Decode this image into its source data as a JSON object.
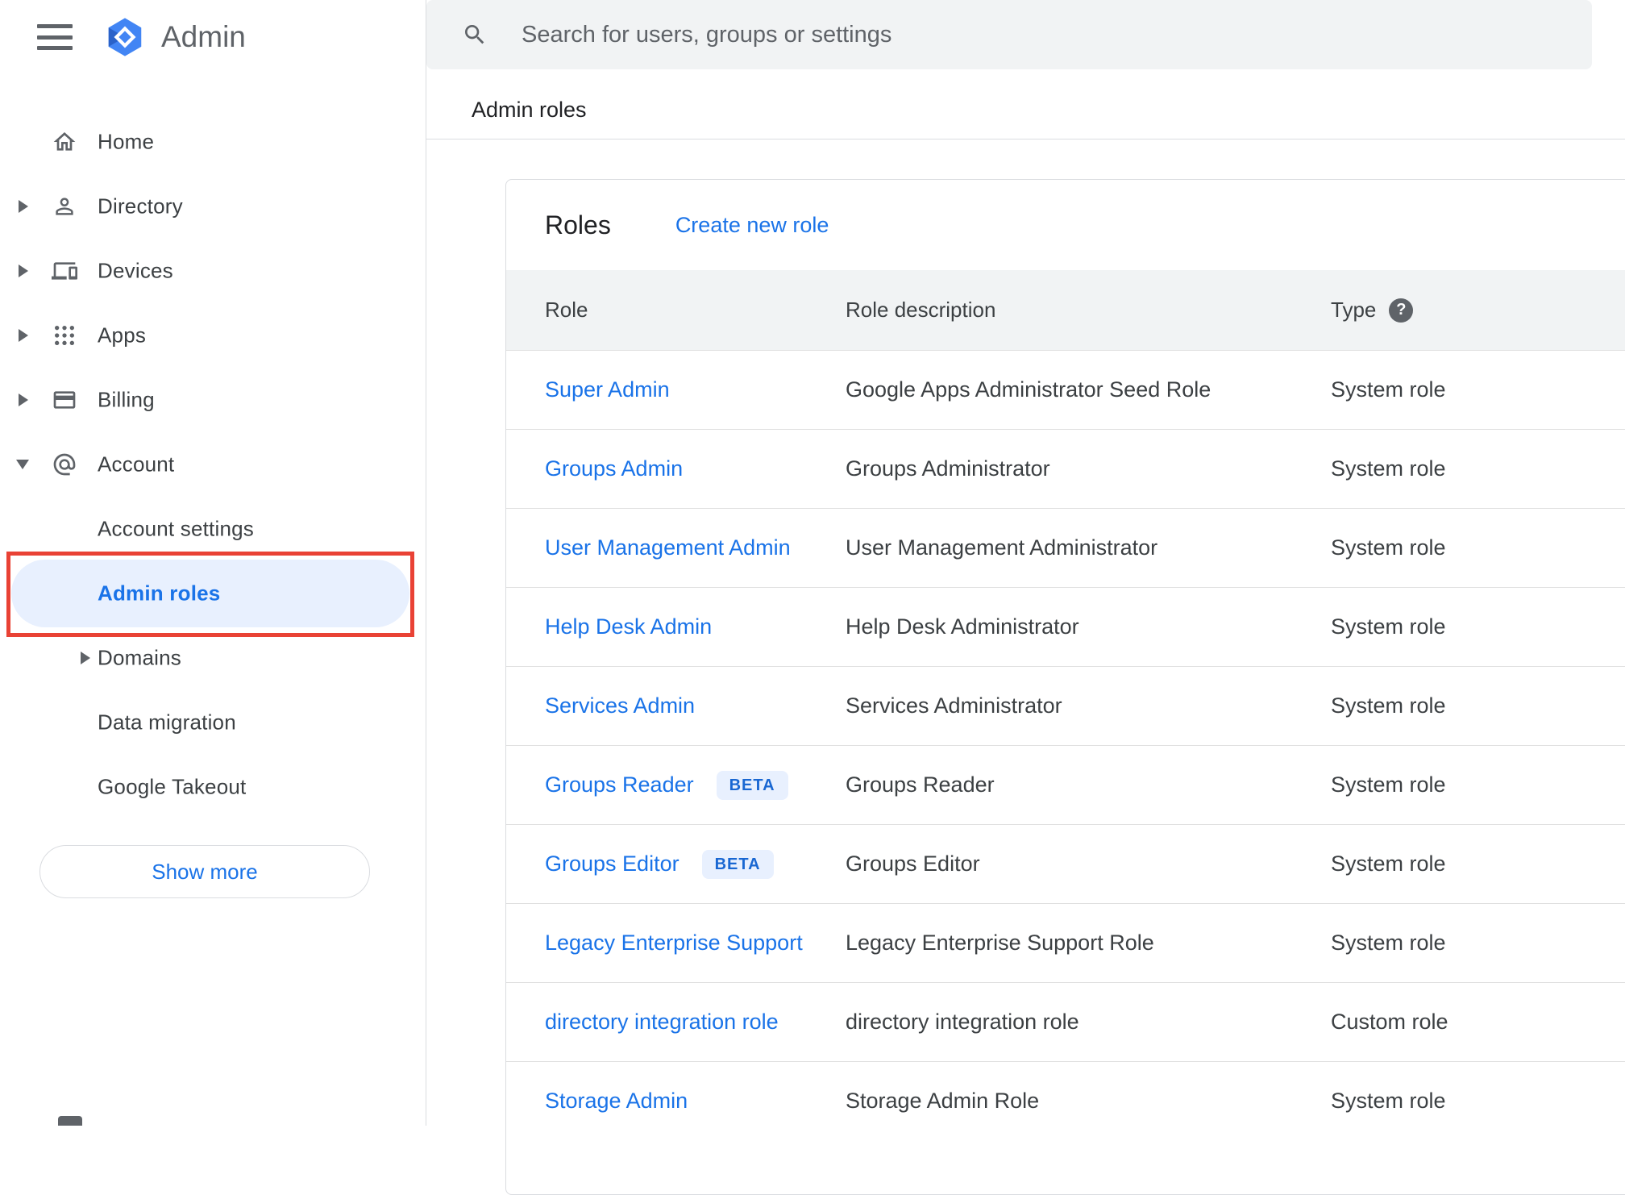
{
  "app": {
    "name": "Admin"
  },
  "search": {
    "placeholder": "Search for users, groups or settings"
  },
  "page": {
    "breadcrumb": "Admin roles"
  },
  "icons": {
    "help_glyph": "?"
  },
  "sidebar": {
    "items": [
      {
        "label": "Home",
        "icon": "home",
        "expandable": false
      },
      {
        "label": "Directory",
        "icon": "person",
        "expandable": true
      },
      {
        "label": "Devices",
        "icon": "devices",
        "expandable": true
      },
      {
        "label": "Apps",
        "icon": "apps-grid",
        "expandable": true
      },
      {
        "label": "Billing",
        "icon": "billing-card",
        "expandable": true
      },
      {
        "label": "Account",
        "icon": "at-sign",
        "expandable": true,
        "expanded": true
      }
    ],
    "account_items": [
      {
        "label": "Account settings",
        "selected": false
      },
      {
        "label": "Admin roles",
        "selected": true,
        "annotated": true
      },
      {
        "label": "Domains",
        "expandable": true,
        "selected": false
      },
      {
        "label": "Data migration",
        "selected": false
      },
      {
        "label": "Google Takeout",
        "selected": false
      }
    ],
    "show_more": "Show more"
  },
  "main": {
    "title": "Roles",
    "create_link": "Create new role",
    "table": {
      "columns": [
        "Role",
        "Role description",
        "Type"
      ],
      "rows": [
        {
          "role": "Super Admin",
          "description": "Google Apps Administrator Seed Role",
          "type": "System role"
        },
        {
          "role": "Groups Admin",
          "description": "Groups Administrator",
          "type": "System role"
        },
        {
          "role": "User Management Admin",
          "description": "User Management Administrator",
          "type": "System role"
        },
        {
          "role": "Help Desk Admin",
          "description": "Help Desk Administrator",
          "type": "System role"
        },
        {
          "role": "Services Admin",
          "description": "Services Administrator",
          "type": "System role"
        },
        {
          "role": "Groups Reader",
          "badge": "BETA",
          "description": "Groups Reader",
          "type": "System role"
        },
        {
          "role": "Groups Editor",
          "badge": "BETA",
          "description": "Groups Editor",
          "type": "System role"
        },
        {
          "role": "Legacy Enterprise Support",
          "description": "Legacy Enterprise Support Role",
          "type": "System role"
        },
        {
          "role": "directory integration role",
          "description": "directory integration role",
          "type": "Custom role"
        },
        {
          "role": "Storage Admin",
          "description": "Storage Admin Role",
          "type": "System role"
        }
      ]
    }
  },
  "colors": {
    "link_blue": "#1a73e8",
    "selected_item_bg": "#e8f0fe",
    "annotation_red": "#e94235",
    "table_header_bg": "#f1f3f4",
    "search_bar_bg": "#f1f3f4",
    "beta_badge_bg": "#e8f0fe",
    "beta_badge_text": "#1967d2",
    "text_primary": "#202124",
    "text_secondary": "#5f6368",
    "logo_blue": "#4285f4"
  }
}
